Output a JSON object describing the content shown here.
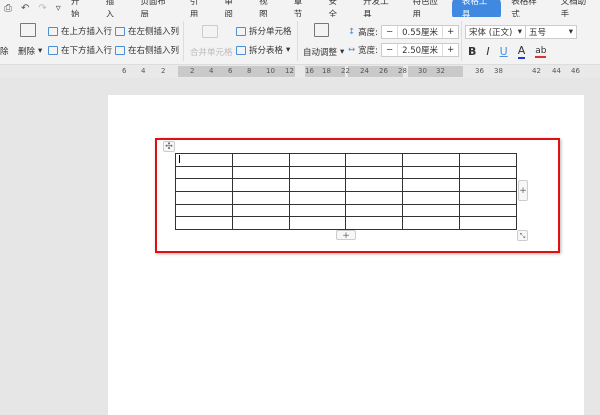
{
  "menubar": {
    "tabs": [
      "开始",
      "插入",
      "页面布局",
      "引用",
      "审阅",
      "视图",
      "章节",
      "安全",
      "开发工具",
      "特色应用",
      "表格工具",
      "表格样式",
      "文档助手"
    ],
    "active_tab": "表格工具",
    "quick": [
      "preview-icon",
      "undo-icon",
      "redo-icon",
      "more-icon"
    ]
  },
  "ribbon": {
    "delete_partial": "除",
    "delete": "删除",
    "insert_above": "在上方插入行",
    "insert_below": "在下方插入行",
    "insert_left": "在左侧插入列",
    "insert_right": "在右侧插入列",
    "merge_cells": "合并单元格",
    "split_cells": "拆分单元格",
    "split_table": "拆分表格",
    "auto_fit": "自动调整",
    "height_label": "高度:",
    "height_value": "0.55厘米",
    "width_label": "宽度:",
    "width_value": "2.50厘米",
    "minus": "−",
    "plus": "+",
    "font_name": "宋体 (正文)",
    "font_size": "五号",
    "bold": "B",
    "italic": "I",
    "underline": "U",
    "font_color": "A",
    "highlight": "ab"
  },
  "ruler": {
    "ticks": [
      "6",
      "4",
      "2",
      "2",
      "4",
      "6",
      "8",
      "10",
      "12",
      "16",
      "18",
      "22",
      "24",
      "26",
      "28",
      "30",
      "32",
      "36",
      "38",
      "42",
      "44",
      "46"
    ]
  },
  "table": {
    "rows": 6,
    "cols": 6
  },
  "handles": {
    "add": "+"
  },
  "colors": {
    "accent": "#3f8ae0",
    "highlight_box": "#e01010"
  }
}
